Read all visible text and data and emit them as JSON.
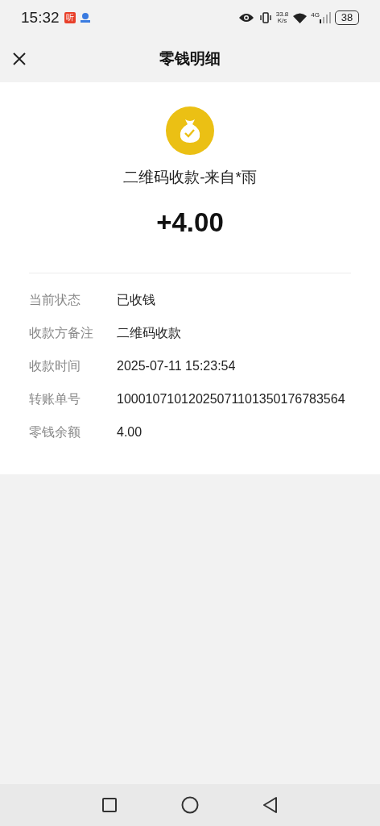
{
  "status_bar": {
    "time": "15:32",
    "app_badge": "听",
    "speed": "33.8",
    "speed_unit": "K/s",
    "network": "4G",
    "battery": "38"
  },
  "header": {
    "title": "零钱明细"
  },
  "summary": {
    "title": "二维码收款-来自*雨",
    "amount": "+4.00"
  },
  "details": [
    {
      "label": "当前状态",
      "value": "已收钱"
    },
    {
      "label": "收款方备注",
      "value": "二维码收款"
    },
    {
      "label": "收款时间",
      "value": "2025-07-11 15:23:54"
    },
    {
      "label": "转账单号",
      "value": "10001071012025071101350176783564"
    },
    {
      "label": "零钱余额",
      "value": "4.00"
    }
  ]
}
